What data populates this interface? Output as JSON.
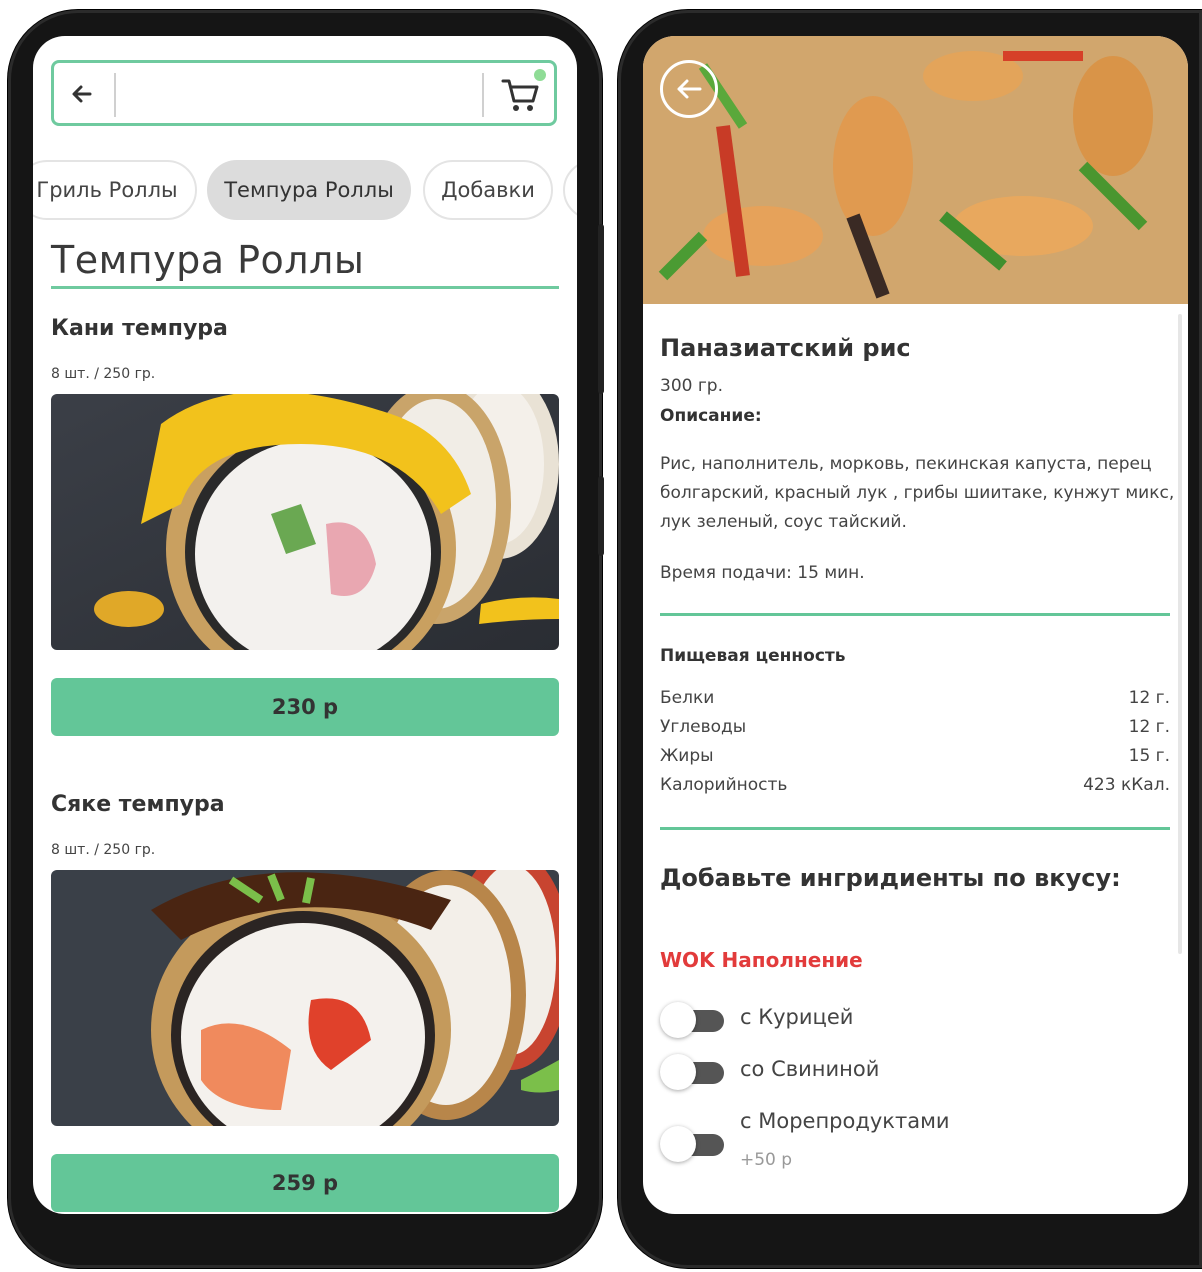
{
  "left_screen": {
    "search": {
      "value": ""
    },
    "categories": [
      {
        "label": "Гриль Роллы",
        "active": false
      },
      {
        "label": "Темпура Роллы",
        "active": true
      },
      {
        "label": "Добавки",
        "active": false
      }
    ],
    "section_title": "Темпура Роллы",
    "products": [
      {
        "name": "Кани темпура",
        "meta": "8 шт. / 250 гр.",
        "price": "230 р"
      },
      {
        "name": "Сяке темпура",
        "meta": "8 шт. / 250 гр.",
        "price": "259 р"
      }
    ]
  },
  "right_screen": {
    "dish_title": "Паназиатский рис",
    "weight": "300 гр.",
    "description_label": "Описание:",
    "description": "Рис, наполнитель, морковь, пекинская капуста, перец болгарский, красный лук , грибы шиитаке, кунжут микс, лук зеленый, соус тайский.",
    "serve_time": "Время подачи: 15 мин.",
    "nutrition_title": "Пищевая ценность",
    "nutrition": [
      {
        "label": "Белки",
        "value": "12 г."
      },
      {
        "label": "Углеводы",
        "value": "12 г."
      },
      {
        "label": "Жиры",
        "value": "15 г."
      },
      {
        "label": "Калорийность",
        "value": "423 кКал."
      }
    ],
    "add_title": "Добавьте ингридиенты по вкусу:",
    "group_label": "WOK Наполнение",
    "options": [
      {
        "label": "с Курицей",
        "price": "",
        "checked": false
      },
      {
        "label": "со Свининой",
        "price": "",
        "checked": false
      },
      {
        "label": "с Морепродуктами",
        "price": "+50 р",
        "checked": false
      }
    ]
  },
  "colors": {
    "accent": "#63c698",
    "outline": "#6fca9f",
    "group_label": "#e23b3b",
    "cart_dot": "#8fdc96"
  },
  "icons": [
    "arrow-left-icon",
    "cart-icon",
    "back-circle-icon",
    "toggle-switch"
  ]
}
